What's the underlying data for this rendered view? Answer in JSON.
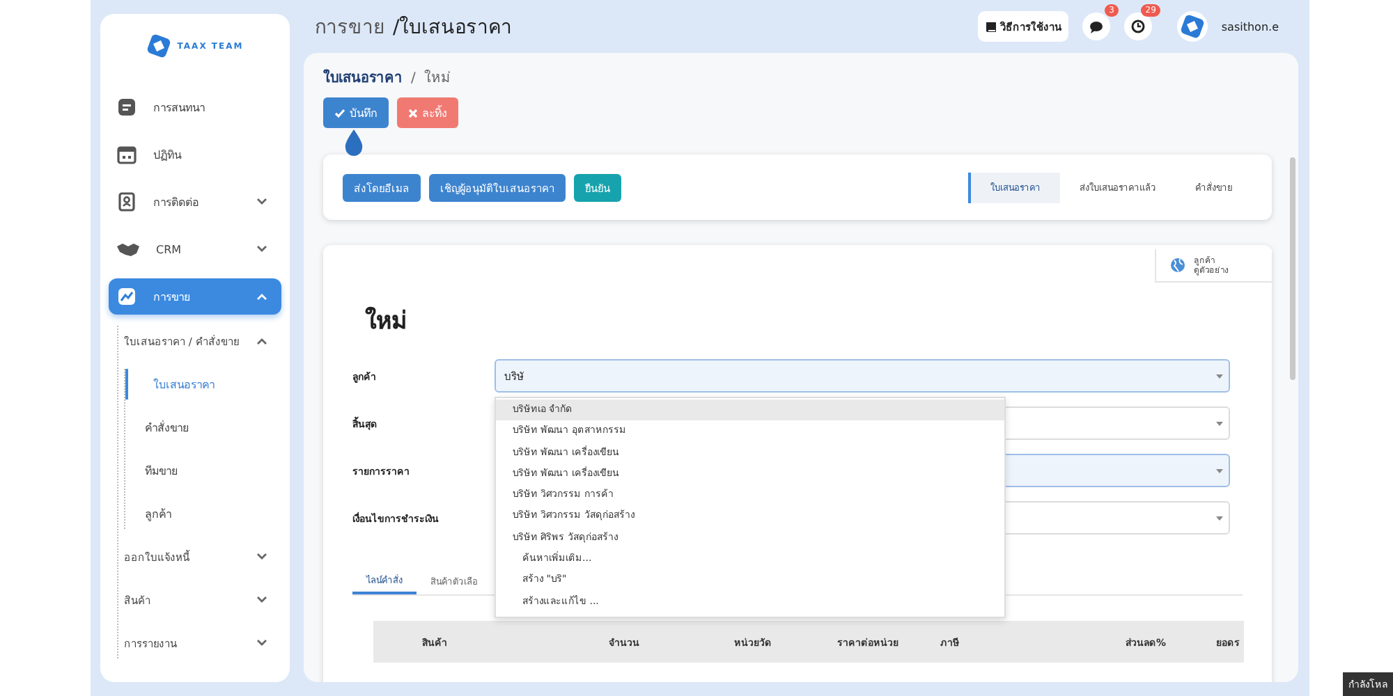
{
  "sidebar": {
    "logo": "TAAX TEAM",
    "items": [
      {
        "label": "การสนทนา",
        "selected": false
      },
      {
        "label": "ปฏิทิน",
        "selected": false
      },
      {
        "label": "การติดต่อ",
        "selected": false,
        "expanded": false
      },
      {
        "label": "CRM",
        "selected": false,
        "expanded": false
      },
      {
        "label": "การขาย",
        "selected": true,
        "expanded": true,
        "children": [
          {
            "label": "ใบเสนอราคา / คำสั่งขาย",
            "selected": false,
            "expanded": true,
            "children": [
              {
                "label": "ใบเสนอราคา",
                "selected": true
              },
              {
                "label": "คำสั่งขาย",
                "selected": false
              },
              {
                "label": "ทีมขาย",
                "selected": false
              },
              {
                "label": "ลูกค้า",
                "selected": false
              }
            ]
          },
          {
            "label": "ออกใบแจ้งหนี้",
            "selected": false,
            "expanded": false
          },
          {
            "label": "สินค้า",
            "selected": false,
            "expanded": false
          },
          {
            "label": "การรายงาน",
            "selected": false,
            "expanded": false
          }
        ]
      }
    ]
  },
  "header": {
    "breadcrumb": [
      "การขาย",
      "/ใบเสนอราคา"
    ],
    "help_button": "วิธีการใช้งาน",
    "messages_badge": "3",
    "activities_badge": "29",
    "user": "sasithon.e"
  },
  "page": {
    "breadcrumb": [
      "ใบเสนอราคา",
      "/",
      "ใหม่"
    ],
    "actions": [
      {
        "label": "บันทึก",
        "kind": "save"
      },
      {
        "label": "ละทิ้ง",
        "kind": "discard"
      }
    ],
    "workflow_buttons": [
      {
        "label": "ส่งโดยอีเมล",
        "kind": "primary"
      },
      {
        "label": "เชิญผู้อนุมัติใบเสนอราคา",
        "kind": "primary"
      },
      {
        "label": "ยืนยัน",
        "kind": "confirm"
      }
    ],
    "stages": [
      {
        "label": "ใบเสนอราคา",
        "selected": true
      },
      {
        "label": "ส่งใบเสนอราคาแล้ว",
        "selected": false
      },
      {
        "label": "คำสั่งขาย",
        "selected": false
      }
    ]
  },
  "form": {
    "smart_button": [
      "ลูกค้า",
      "ดูตัวอย่าง"
    ],
    "title": "ใหม่",
    "fields": [
      {
        "label": "ลูกค้า",
        "value": "บริษั",
        "focused": true
      },
      {
        "label": "สิ้นสุด",
        "focused": false
      },
      {
        "label": "รายการราคา",
        "focused": true
      },
      {
        "label": "เงื่อนไขการชำระเงิน",
        "focused": false
      }
    ],
    "dropdown": [
      {
        "label": "บริษัทเอ จำกัด",
        "kind": "option",
        "selected": true
      },
      {
        "label": "บริษัท พัฒนา อุตสาหกรรม",
        "kind": "option",
        "selected": false
      },
      {
        "label": "บริษัท พัฒนา เครื่องเขียน",
        "kind": "option",
        "selected": false
      },
      {
        "label": "บริษัท พัฒนา เครื่องเขียน",
        "kind": "option",
        "selected": false
      },
      {
        "label": "บริษัท วิศวกรรม การค้า",
        "kind": "option",
        "selected": false
      },
      {
        "label": "บริษัท วิศวกรรม วัสดุก่อสร้าง",
        "kind": "option",
        "selected": false
      },
      {
        "label": "บริษัท ศิริพร วัสดุก่อสร้าง",
        "kind": "option",
        "selected": false
      },
      {
        "label": "ค้นหาเพิ่มเติม...",
        "kind": "action",
        "selected": false
      },
      {
        "label": "สร้าง \"บริ\"",
        "kind": "action",
        "selected": false
      },
      {
        "label": "สร้างและแก้ไข ...",
        "kind": "action",
        "selected": false
      }
    ],
    "tabs": [
      {
        "label": "ไลน์คำสั่ง",
        "selected": true
      },
      {
        "label": "สินค้าตัวเลือ",
        "selected": false
      }
    ],
    "table": {
      "columns": [
        "สินค้า",
        "จำนวน",
        "หน่วยวัด",
        "ราคาต่อหน่วย",
        "ภาษี",
        "ส่วนลด%",
        "ยอดร"
      ]
    }
  },
  "loading_label": "กำลังโหล"
}
